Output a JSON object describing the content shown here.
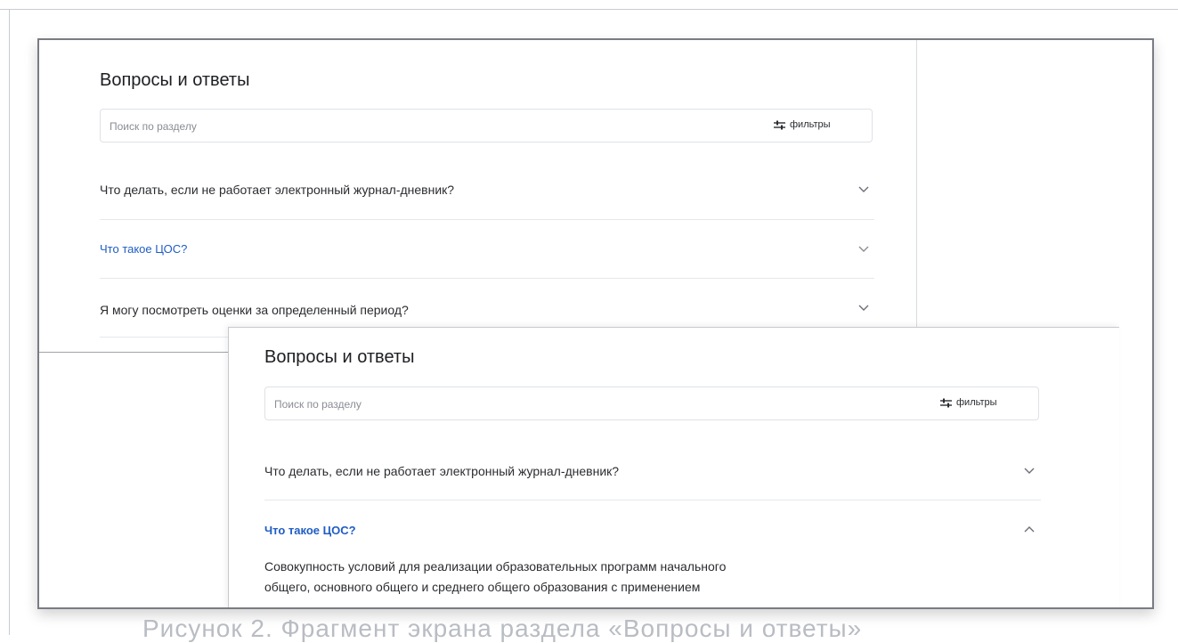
{
  "back_panel": {
    "title": "Вопросы и ответы",
    "search": {
      "placeholder": "Поиск по разделу",
      "filters_label": "фильтры"
    },
    "items": [
      {
        "question": "Что делать, если не работает электронный журнал-дневник?",
        "state": "collapsed",
        "chevron": "chevron-down-icon"
      },
      {
        "question": "Что такое ЦОС?",
        "state": "collapsed-highlighted",
        "chevron": "chevron-down-icon"
      },
      {
        "question": "Я могу посмотреть оценки за определенный период?",
        "state": "collapsed",
        "chevron": "chevron-down-icon"
      }
    ]
  },
  "front_panel": {
    "title": "Вопросы и ответы",
    "search": {
      "placeholder": "Поиск по разделу",
      "filters_label": "фильтры"
    },
    "items": [
      {
        "question": "Что делать, если не работает электронный журнал-дневник?",
        "state": "collapsed",
        "chevron": "chevron-down-icon"
      },
      {
        "question": "Что такое ЦОС?",
        "state": "expanded",
        "chevron": "chevron-up-icon",
        "answer_line_1": "Совокупность условий для реализации образовательных программ начального",
        "answer_line_2": "общего, основного общего и среднего общего образования с применением"
      }
    ]
  },
  "colors": {
    "accent": "#1f5dc2",
    "text": "#2b2c30",
    "divider": "#e6e8ec",
    "frame": "#7a7c84"
  },
  "caption_fragment": "Рисунок 2. Фрагмент экрана раздела «Вопросы и ответы»"
}
